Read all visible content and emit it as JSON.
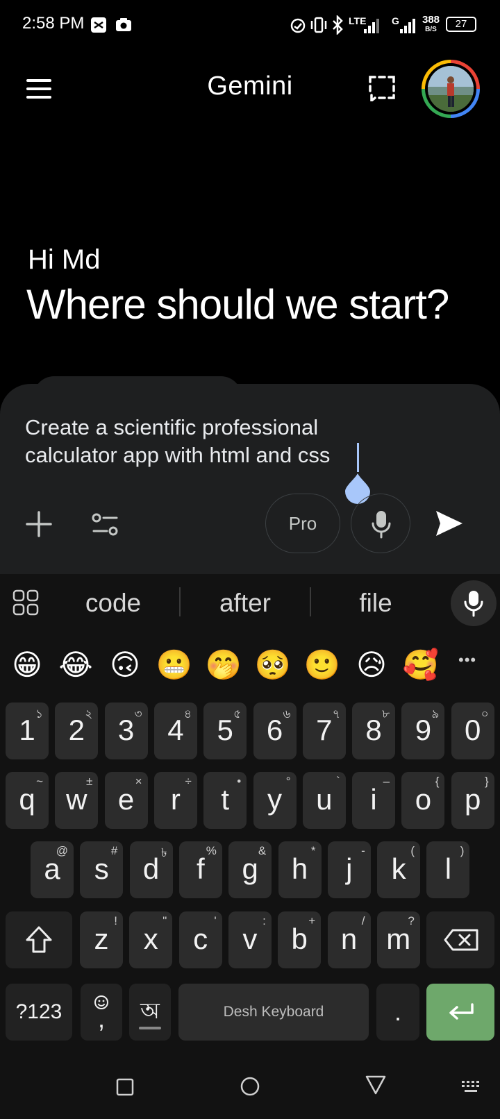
{
  "status_bar": {
    "time": "2:58 PM",
    "lte_label": "LTE",
    "g_label": "G",
    "speed_value": "388",
    "speed_unit": "B/S",
    "battery": "27"
  },
  "header": {
    "title": "Gemini",
    "menu_icon": "hamburger-menu-icon",
    "screenshot_icon": "dashed-selection-icon",
    "avatar_icon": "user-avatar"
  },
  "hero": {
    "greeting": "Hi Md",
    "headline": "Where should we start?"
  },
  "composer": {
    "prompt_text": "Create a scientific professional calculator app with html and css",
    "model_label": "Pro",
    "accent": "#a8c7fa"
  },
  "keyboard": {
    "suggestions": [
      "code",
      "after",
      "file"
    ],
    "emojis": [
      "😁",
      "😂",
      "🙃",
      "😬",
      "🤭",
      "🥺",
      "🙂",
      "😥",
      "🥰"
    ],
    "more_label": "•••",
    "row_numbers": [
      {
        "main": "1",
        "sup": "১"
      },
      {
        "main": "2",
        "sup": "২"
      },
      {
        "main": "3",
        "sup": "৩"
      },
      {
        "main": "4",
        "sup": "৪"
      },
      {
        "main": "5",
        "sup": "৫"
      },
      {
        "main": "6",
        "sup": "৬"
      },
      {
        "main": "7",
        "sup": "৭"
      },
      {
        "main": "8",
        "sup": "৮"
      },
      {
        "main": "9",
        "sup": "৯"
      },
      {
        "main": "0",
        "sup": "০"
      }
    ],
    "row_q": [
      {
        "main": "q",
        "sup": "~"
      },
      {
        "main": "w",
        "sup": "±"
      },
      {
        "main": "e",
        "sup": "×"
      },
      {
        "main": "r",
        "sup": "÷"
      },
      {
        "main": "t",
        "sup": "•"
      },
      {
        "main": "y",
        "sup": "°"
      },
      {
        "main": "u",
        "sup": "`"
      },
      {
        "main": "i",
        "sup": "–"
      },
      {
        "main": "o",
        "sup": "{"
      },
      {
        "main": "p",
        "sup": "}"
      }
    ],
    "row_a": [
      {
        "main": "a",
        "sup": "@"
      },
      {
        "main": "s",
        "sup": "#"
      },
      {
        "main": "d",
        "sup": "৳"
      },
      {
        "main": "f",
        "sup": "%"
      },
      {
        "main": "g",
        "sup": "&"
      },
      {
        "main": "h",
        "sup": "*"
      },
      {
        "main": "j",
        "sup": "-"
      },
      {
        "main": "k",
        "sup": "("
      },
      {
        "main": "l",
        "sup": ")"
      }
    ],
    "row_z": [
      {
        "main": "z",
        "sup": "!"
      },
      {
        "main": "x",
        "sup": "\""
      },
      {
        "main": "c",
        "sup": "'"
      },
      {
        "main": "v",
        "sup": ":"
      },
      {
        "main": "b",
        "sup": "+"
      },
      {
        "main": "n",
        "sup": "/"
      },
      {
        "main": "m",
        "sup": "?"
      }
    ],
    "symbols_label": "?123",
    "comma_label": ",",
    "lang_label": "অ",
    "space_label": "Desh Keyboard",
    "period_label": ".",
    "enter_color": "#6ea86b"
  }
}
